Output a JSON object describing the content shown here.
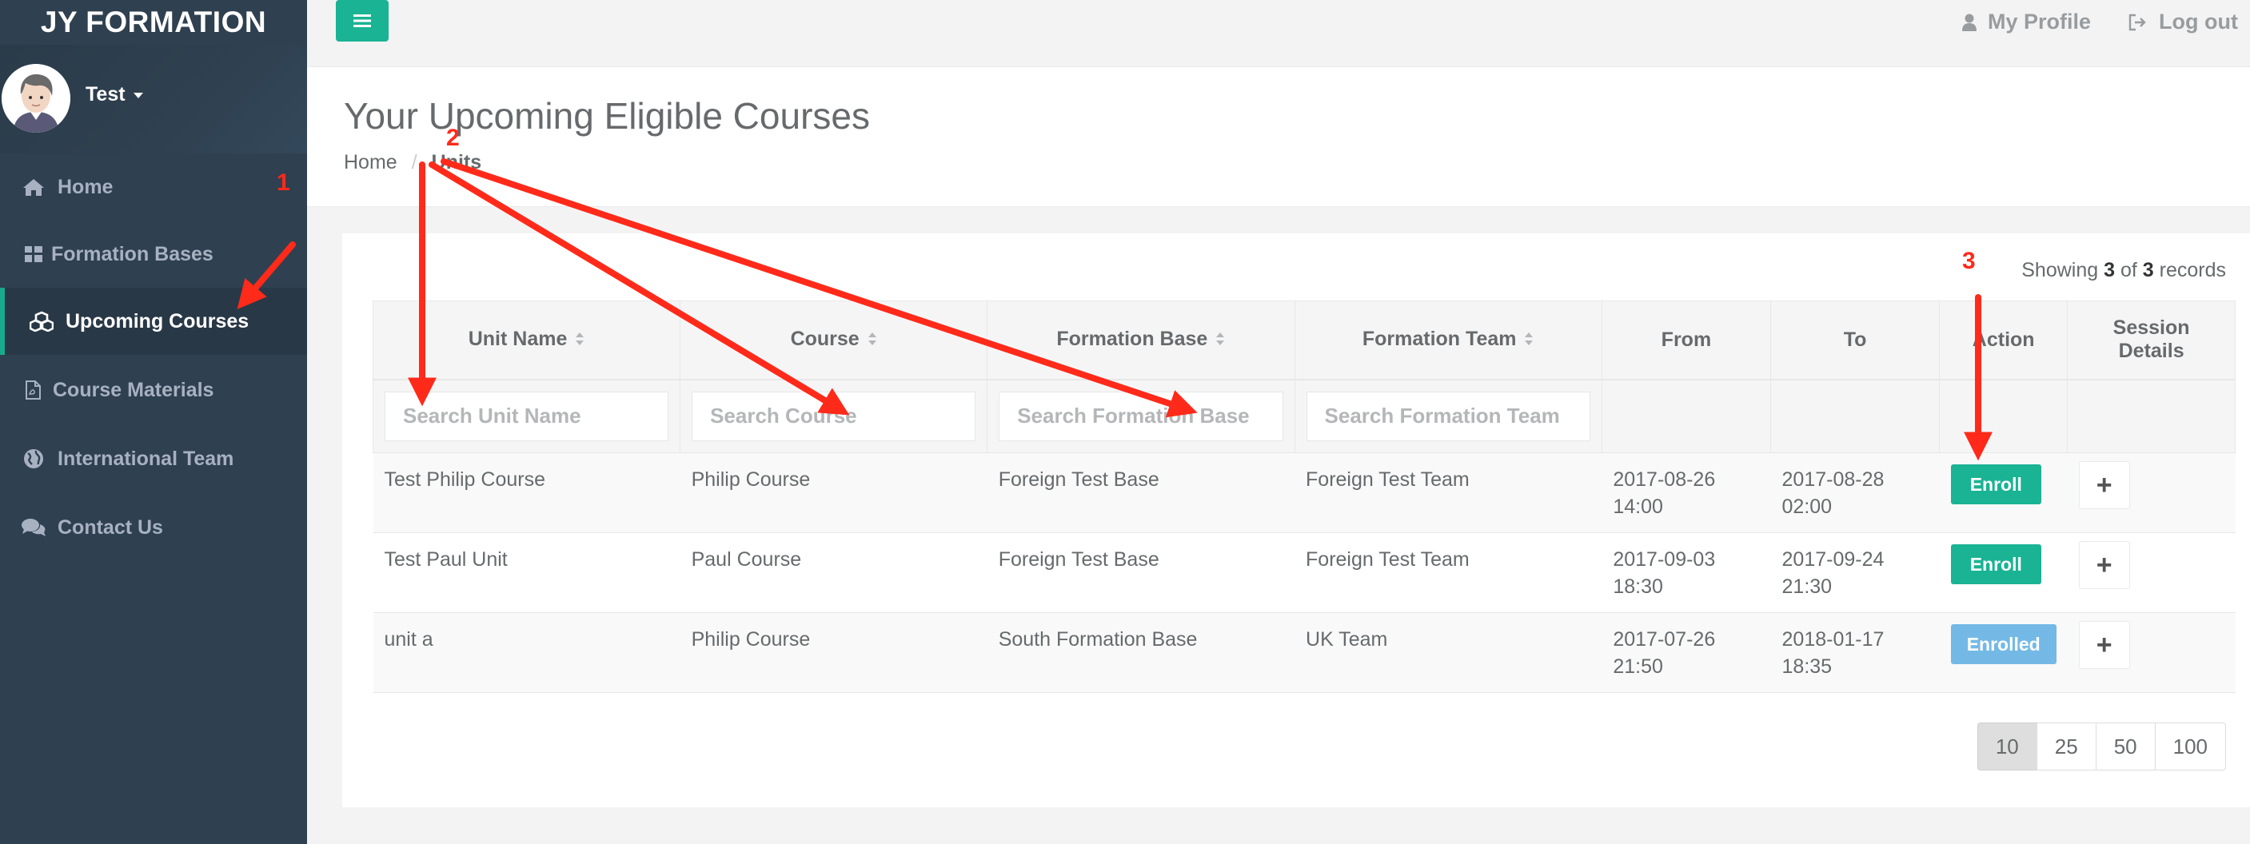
{
  "brand": "JY FORMATION",
  "user": {
    "name": "Test"
  },
  "sidebar": {
    "items": [
      {
        "label": "Home",
        "icon": "home-icon"
      },
      {
        "label": "Formation Bases",
        "icon": "grid-icon"
      },
      {
        "label": "Upcoming Courses",
        "icon": "cubes-icon",
        "active": true
      },
      {
        "label": "Course Materials",
        "icon": "pdf-file-icon"
      },
      {
        "label": "International Team",
        "icon": "globe-icon"
      },
      {
        "label": "Contact Us",
        "icon": "comments-icon"
      }
    ]
  },
  "topbar": {
    "profile_label": "My Profile",
    "logout_label": "Log out"
  },
  "page": {
    "title": "Your Upcoming Eligible Courses",
    "breadcrumb": {
      "home": "Home",
      "separator": "/",
      "current": "Units"
    }
  },
  "table": {
    "showing_prefix": "Showing",
    "showing_count": "3",
    "showing_of": "of",
    "showing_total": "3",
    "showing_suffix": "records",
    "headers": [
      "Unit Name",
      "Course",
      "Formation Base",
      "Formation Team",
      "From",
      "To",
      "Action",
      "Session Details"
    ],
    "filters": {
      "unit_name": "Search Unit Name",
      "course": "Search Course",
      "formation_base": "Search Formation Base",
      "formation_team": "Search Formation Team"
    },
    "rows": [
      {
        "unit": "Test Philip Course",
        "course": "Philip Course",
        "base": "Foreign Test Base",
        "team": "Foreign Test Team",
        "from_date": "2017-08-26",
        "from_time": "14:00",
        "to_date": "2017-08-28",
        "to_time": "02:00",
        "action": "Enroll",
        "details": "+"
      },
      {
        "unit": "Test Paul Unit",
        "course": "Paul Course",
        "base": "Foreign Test Base",
        "team": "Foreign Test Team",
        "from_date": "2017-09-03",
        "from_time": "18:30",
        "to_date": "2017-09-24",
        "to_time": "21:30",
        "action": "Enroll",
        "details": "+"
      },
      {
        "unit": "unit a",
        "course": "Philip Course",
        "base": "South Formation Base",
        "team": "UK Team",
        "from_date": "2017-07-26",
        "from_time": "21:50",
        "to_date": "2018-01-17",
        "to_time": "18:35",
        "action": "Enrolled",
        "details": "+"
      }
    ]
  },
  "pagination": [
    "10",
    "25",
    "50",
    "100"
  ],
  "annotations": [
    "1",
    "2",
    "3"
  ],
  "colors": {
    "sidebar": "#2f4050",
    "accent": "#1ab394",
    "enrolled": "#74b9e6",
    "annotation": "#ff2a1a"
  }
}
